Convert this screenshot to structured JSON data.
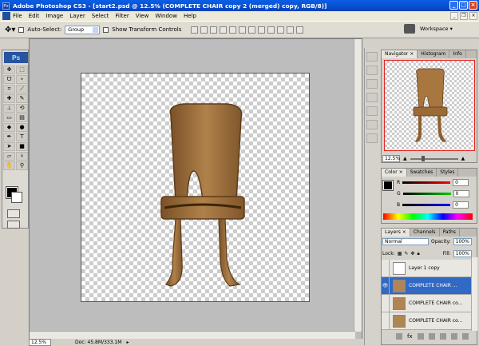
{
  "window": {
    "title": "Adobe Photoshop CS3 - [start2.psd @ 12.5% (COMPLETE CHAIR copy 2 (merged) copy, RGB/8)]"
  },
  "menu": [
    "File",
    "Edit",
    "Image",
    "Layer",
    "Select",
    "Filter",
    "View",
    "Window",
    "Help"
  ],
  "options": {
    "auto_select_label": "Auto-Select:",
    "auto_select_value": "Group",
    "transform_label": "Show Transform Controls",
    "workspace_label": "Workspace ▾"
  },
  "status": {
    "zoom": "12.5%",
    "doc": "Doc: 45.8M/333.1M"
  },
  "navigator": {
    "tabs": [
      "Navigator ×",
      "Histogram",
      "Info"
    ],
    "zoom": "12.5%"
  },
  "color_panel": {
    "tabs": [
      "Color ×",
      "Swatches",
      "Styles"
    ],
    "channels": [
      {
        "name": "R",
        "value": "0",
        "color": "#e02020"
      },
      {
        "name": "G",
        "value": "0",
        "color": "#20a020"
      },
      {
        "name": "B",
        "value": "0",
        "color": "#2020e0"
      }
    ]
  },
  "layers": {
    "tabs": [
      "Layers ×",
      "Channels",
      "Paths"
    ],
    "blend_mode": "Normal",
    "opacity_label": "Opacity:",
    "opacity_value": "100%",
    "lock_label": "Lock:",
    "fill_label": "Fill:",
    "fill_value": "100%",
    "items": [
      {
        "name": "Layer 1 copy"
      },
      {
        "name": "COMPLETE CHAIR ..."
      },
      {
        "name": "COMPLETE CHAIR co..."
      },
      {
        "name": "COMPLETE CHAIR co..."
      }
    ]
  }
}
